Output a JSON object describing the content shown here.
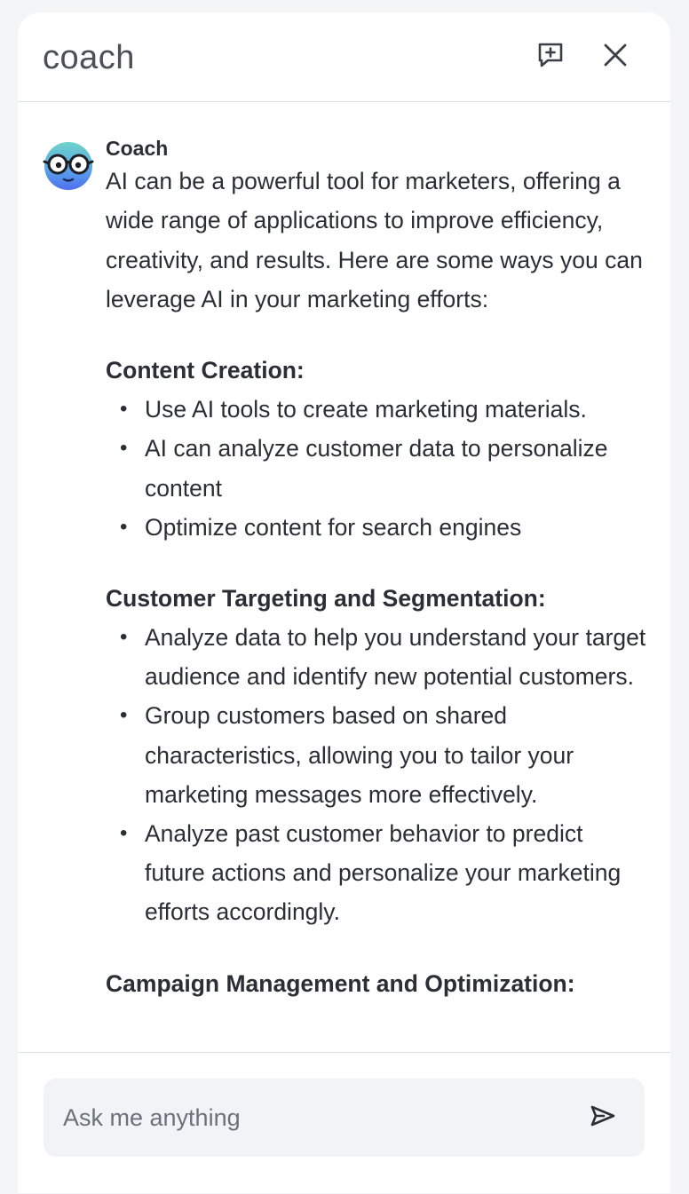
{
  "header": {
    "logo": "coach",
    "icons": {
      "new_chat": "message-plus-icon",
      "close": "close-icon"
    }
  },
  "message": {
    "sender": "Coach",
    "avatar": "coach-avatar-glasses",
    "intro": "AI can be a powerful tool for marketers, offering a wide range of applications to improve efficiency, creativity, and results. Here are some ways you can leverage AI in your marketing efforts:",
    "sections": [
      {
        "title": "Content Creation:",
        "items": [
          "Use AI tools to create marketing materials.",
          "AI can analyze customer data to personalize content",
          "Optimize content for search engines"
        ]
      },
      {
        "title": "Customer Targeting and Segmentation:",
        "items": [
          "Analyze data to help you understand your target audience and identify new potential customers.",
          "Group customers based on shared characteristics, allowing you to tailor your marketing messages more effectively.",
          "Analyze past customer behavior to predict future actions and personalize your marketing efforts accordingly."
        ]
      },
      {
        "title": "Campaign Management and Optimization:",
        "items": []
      }
    ]
  },
  "composer": {
    "placeholder": "Ask me anything",
    "send_icon": "send-icon"
  },
  "colors": {
    "panel_bg": "#ffffff",
    "page_bg": "#f4f5f7",
    "input_bg": "#f1f3f6",
    "text": "#2a2e35",
    "avatar_blue": "#4f7df0",
    "avatar_teal": "#6fd3c9"
  }
}
